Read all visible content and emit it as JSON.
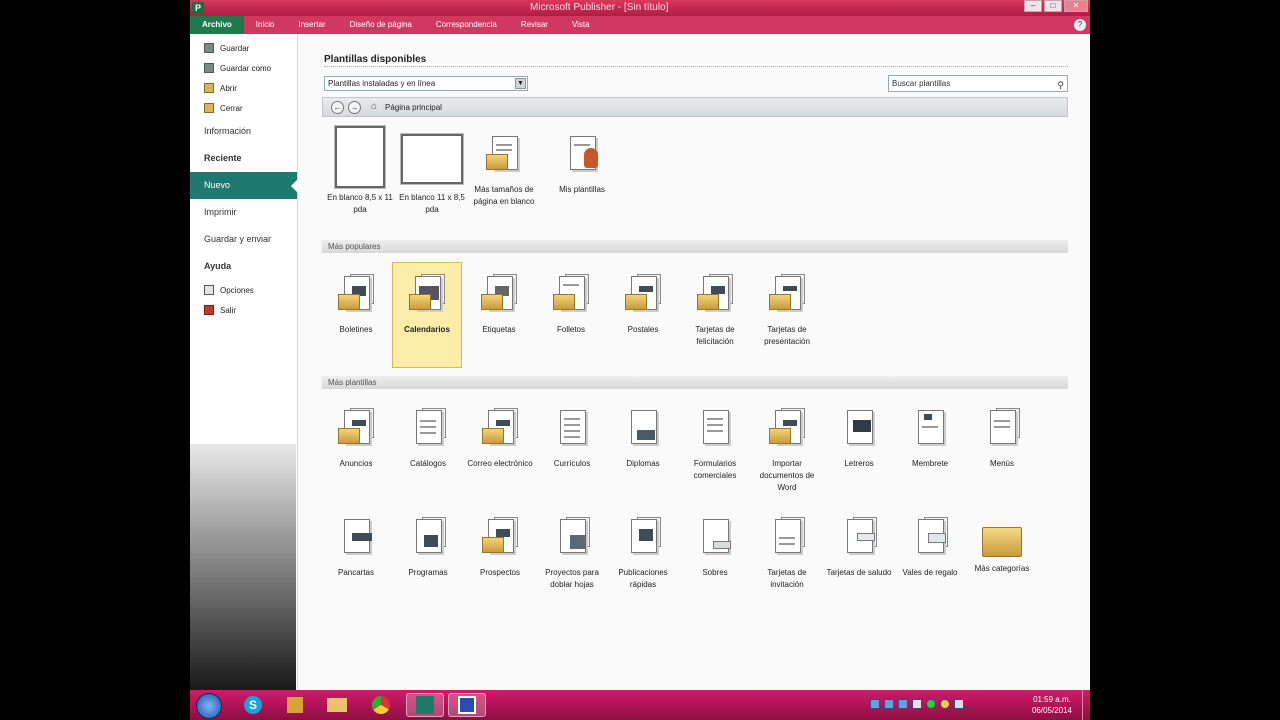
{
  "window": {
    "title": "Microsoft Publisher - [Sin título]"
  },
  "ribbon_tabs": [
    "Archivo",
    "Inicio",
    "Insertar",
    "Diseño de página",
    "Correspondencia",
    "Revisar",
    "Vista"
  ],
  "leftnav": {
    "guardar": "Guardar",
    "guardar_como": "Guardar como",
    "abrir": "Abrir",
    "cerrar": "Cerrar",
    "informacion": "Información",
    "reciente": "Reciente",
    "nuevo": "Nuevo",
    "imprimir": "Imprimir",
    "guardar_enviar": "Guardar y enviar",
    "ayuda": "Ayuda",
    "opciones": "Opciones",
    "salir": "Salir"
  },
  "main": {
    "title": "Plantillas disponibles",
    "filter_value": "Plantillas instaladas y en línea",
    "search_placeholder": "Buscar plantillas",
    "home_label": "Página principal",
    "section_popular": "Más populares",
    "section_more": "Más plantillas",
    "blank_tiles": [
      {
        "label": "En blanco 8,5 x 11 pda"
      },
      {
        "label": "En blanco 11 x 8,5 pda"
      },
      {
        "label": "Más tamaños de página en blanco"
      },
      {
        "label": "Mis plantillas"
      }
    ],
    "popular_tiles": [
      {
        "label": "Boletines"
      },
      {
        "label": "Calendarios"
      },
      {
        "label": "Etiquetas"
      },
      {
        "label": "Folletos"
      },
      {
        "label": "Postales"
      },
      {
        "label": "Tarjetas de felicitación"
      },
      {
        "label": "Tarjetas de presentación"
      }
    ],
    "more_tiles_row1": [
      {
        "label": "Anuncios"
      },
      {
        "label": "Catálogos"
      },
      {
        "label": "Correo electrónico"
      },
      {
        "label": "Currículos"
      },
      {
        "label": "Diplomas"
      },
      {
        "label": "Formularios comerciales"
      },
      {
        "label": "Importar documentos de Word"
      },
      {
        "label": "Letreros"
      },
      {
        "label": "Membrete"
      },
      {
        "label": "Menús"
      }
    ],
    "more_tiles_row2": [
      {
        "label": "Pancartas"
      },
      {
        "label": "Programas"
      },
      {
        "label": "Prospectos"
      },
      {
        "label": "Proyectos para doblar hojas"
      },
      {
        "label": "Publicaciones rápidas"
      },
      {
        "label": "Sobres"
      },
      {
        "label": "Tarjetas de invitación"
      },
      {
        "label": "Tarjetas de saludo"
      },
      {
        "label": "Vales de regalo"
      },
      {
        "label": "Más categorías"
      }
    ]
  },
  "taskbar": {
    "clock_time": "01:59 a.m.",
    "clock_date": "06/05/2014",
    "apps": [
      "S"
    ]
  },
  "colors": {
    "accent": "#1e7a6e",
    "titlebar": "#d13860",
    "taskbar": "#b3125a",
    "selected_tile": "#fbecaa"
  }
}
